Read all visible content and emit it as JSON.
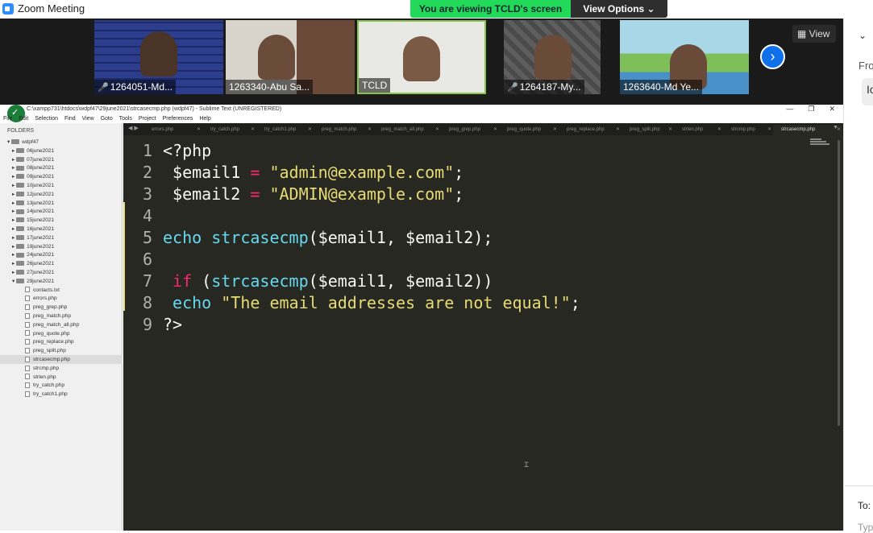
{
  "window": {
    "title": "Zoom Meeting"
  },
  "banner": {
    "message": "You are viewing TCLD's screen",
    "view_options": "View Options ⌄"
  },
  "participants": [
    {
      "name": "1264051-Md...",
      "muted": true
    },
    {
      "name": "1263340-Abu Sa...",
      "muted": false
    },
    {
      "name": "TCLD",
      "muted": false
    },
    {
      "name": "1264187-My...",
      "muted": true
    },
    {
      "name": "1263640-Md Ye...",
      "muted": false
    }
  ],
  "view_button": "View",
  "chat": {
    "from_label": "Fro",
    "from_value": "Io",
    "to_label": "To:",
    "type_placeholder": "Typ"
  },
  "sublime": {
    "title": "C:\\xampp731\\htdocs\\wdpf47\\29june2021\\strcasecmp.php (wdpf47) - Sublime Text (UNREGISTERED)",
    "menu": [
      "File",
      "Edit",
      "Selection",
      "Find",
      "View",
      "Goto",
      "Tools",
      "Project",
      "Preferences",
      "Help"
    ],
    "folders_label": "FOLDERS",
    "root": "wdpf47",
    "folders": [
      "06june2021",
      "07june2021",
      "08june2021",
      "09june2021",
      "10june2021",
      "12june2021",
      "13june2021",
      "14june2021",
      "15june2021",
      "16june2021",
      "17june2021",
      "19june2021",
      "24june2021",
      "26june2021",
      "27june2021",
      "29june2021"
    ],
    "files": [
      "contacts.txt",
      "errors.php",
      "preg_grep.php",
      "preg_match.php",
      "preg_match_all.php",
      "preg_quote.php",
      "preg_replace.php",
      "preg_split.php",
      "strcasecmp.php",
      "strcmp.php",
      "strlen.php",
      "try_catch.php",
      "try_catch1.php"
    ],
    "selected_file": "strcasecmp.php",
    "tabs": [
      "errors.php",
      "try_catch.php",
      "try_catch1.php",
      "preg_match.php",
      "preg_match_all.php",
      "preg_grep.php",
      "preg_quote.php",
      "preg_replace.php",
      "preg_split.php",
      "strlen.php",
      "strcmp.php",
      "strcasecmp.php"
    ],
    "active_tab": "strcasecmp.php",
    "line_numbers": [
      "1",
      "2",
      "3",
      "4",
      "5",
      "6",
      "7",
      "8",
      "9"
    ]
  },
  "code": {
    "l1": "<?php",
    "l2_var": " $email1",
    "l2_op": " = ",
    "l2_str": "\"admin@example.com\"",
    "l2_end": ";",
    "l3_var": " $email2",
    "l3_op": " = ",
    "l3_str": "\"ADMIN@example.com\"",
    "l3_end": ";",
    "l5_kw": "echo ",
    "l5_fn": "strcasecmp",
    "l5_rest": "($email1, $email2);",
    "l7_kw": " if ",
    "l7_p": "(",
    "l7_fn": "strcasecmp",
    "l7_rest": "($email1, $email2))",
    "l8_kw": " echo ",
    "l8_str": "\"The email addresses are not equal!\"",
    "l8_end": ";",
    "l9": "?>"
  }
}
